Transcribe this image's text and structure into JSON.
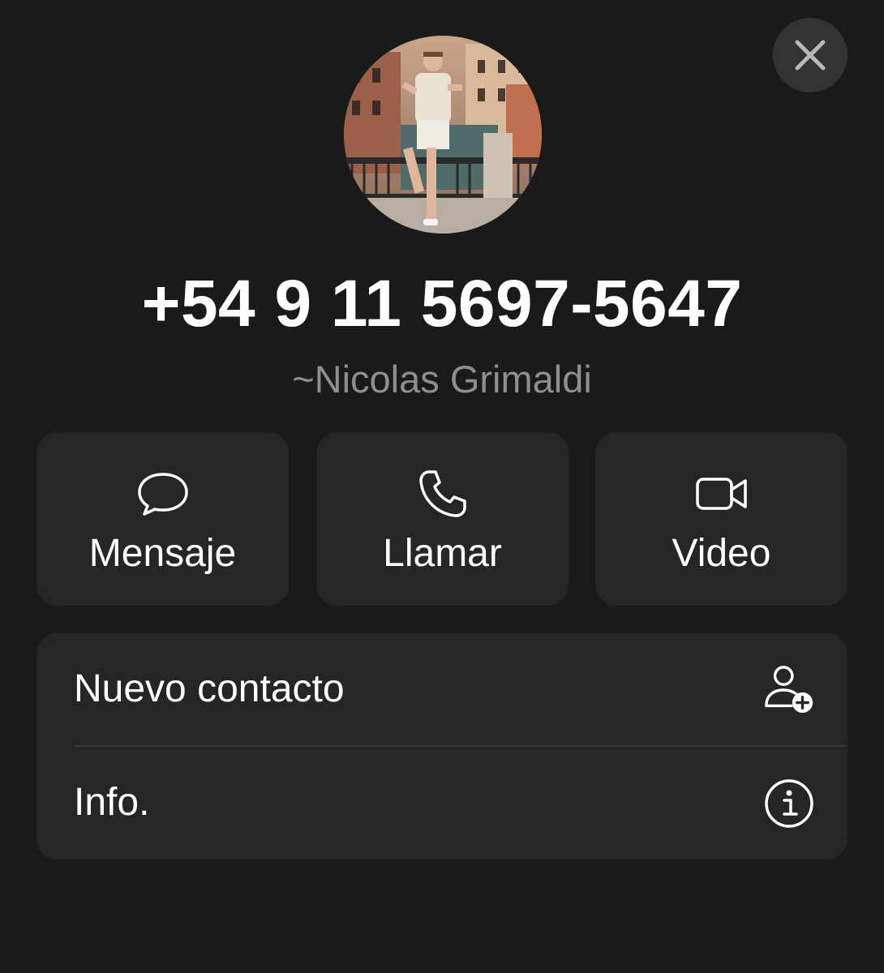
{
  "header": {
    "close_icon": "close-icon"
  },
  "contact": {
    "phone": "+54 9 11 5697-5647",
    "alias": "~Nicolas Grimaldi",
    "avatar": "profile-photo"
  },
  "actions": [
    {
      "label": "Mensaje",
      "icon": "message-bubble-icon"
    },
    {
      "label": "Llamar",
      "icon": "phone-icon"
    },
    {
      "label": "Video",
      "icon": "video-camera-icon"
    }
  ],
  "list": [
    {
      "label": "Nuevo contacto",
      "icon": "add-person-icon"
    },
    {
      "label": "Info.",
      "icon": "info-icon"
    }
  ],
  "colors": {
    "background": "#1a1a1a",
    "card": "#262626",
    "secondary_text": "#8e8e93",
    "close_button": "#333333"
  }
}
